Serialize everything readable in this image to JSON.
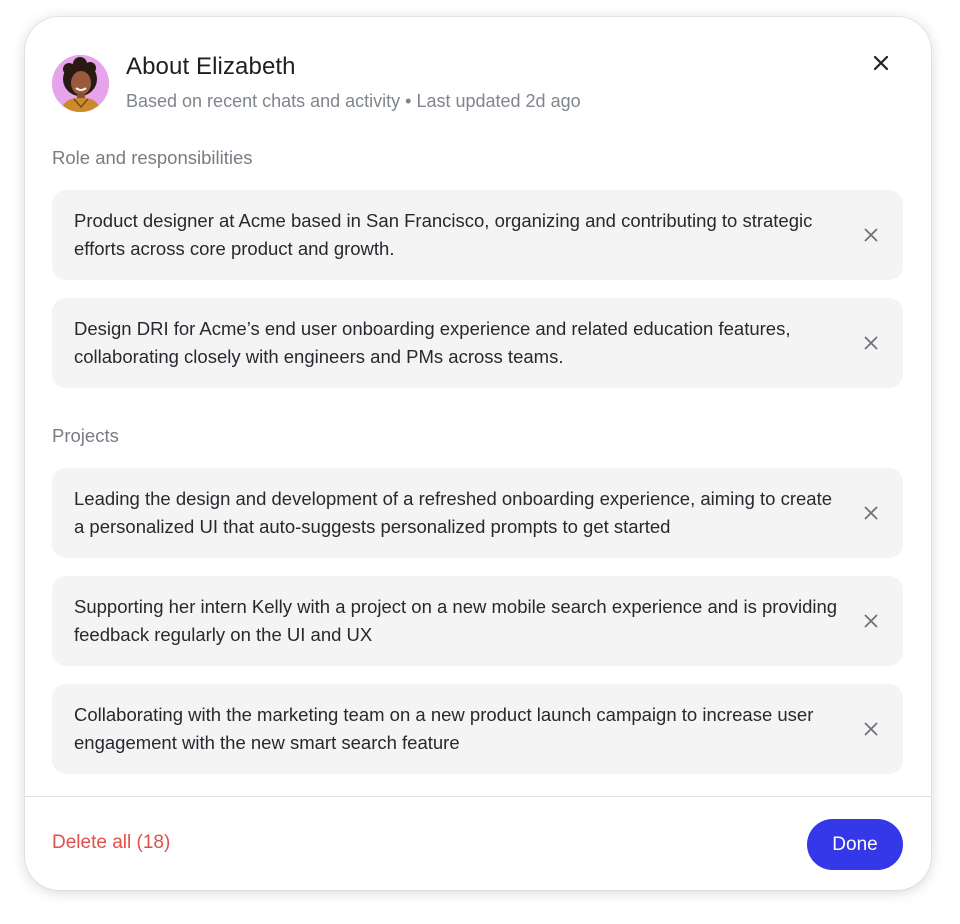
{
  "header": {
    "title": "About Elizabeth",
    "subtitle": "Based on recent chats and activity • Last updated 2d ago",
    "avatar_icon": "person-avatar",
    "close_icon": "close-icon"
  },
  "sections": [
    {
      "label": "Role and responsibilities",
      "items": [
        "Product designer at Acme based in San Francisco, organizing and contributing to strategic efforts across core product and growth.",
        "Design DRI for Acme’s end user onboarding experience and related education features, collaborating closely with engineers and PMs across teams."
      ]
    },
    {
      "label": "Projects",
      "items": [
        "Leading the design and development of a refreshed onboarding experience, aiming to create a personalized UI that auto-suggests personalized prompts to get started",
        "Supporting her intern Kelly with a project on a new mobile search experience and is providing feedback regularly on the UI and UX",
        "Collaborating with the marketing team on a new product launch campaign to increase user engagement with the new smart search feature"
      ]
    }
  ],
  "footer": {
    "delete_all_label": "Delete all (18)",
    "done_label": "Done"
  },
  "colors": {
    "accent": "#3438e8",
    "danger": "#e0504b",
    "card_bg": "#f4f4f5",
    "avatar_bg": "#e7a3ec"
  }
}
